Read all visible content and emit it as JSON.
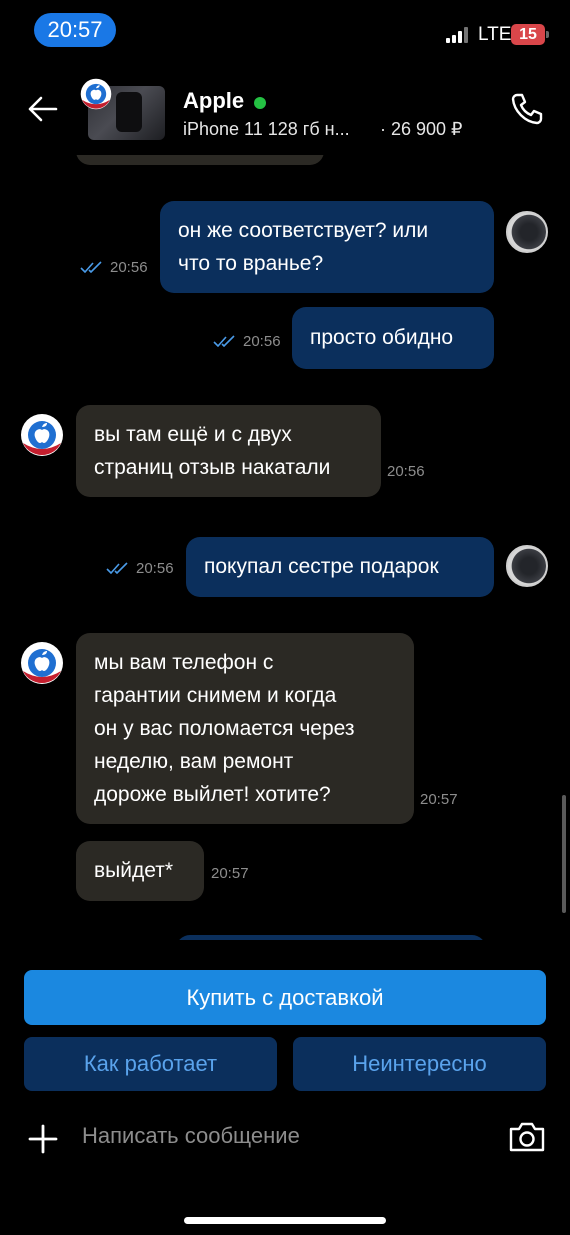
{
  "status_bar": {
    "time": "20:57",
    "network": "LTE",
    "battery": "15"
  },
  "header": {
    "seller_name": "Apple",
    "online_status_color": "#24c143",
    "product_title": "iPhone 11 128 гб н...",
    "product_price": "· 26 900 ₽"
  },
  "messages": [
    {
      "direction": "out",
      "lines": [
        "он же соответствует? или",
        "что то вранье?"
      ],
      "time": "20:56",
      "read": true
    },
    {
      "direction": "out",
      "lines": [
        "просто обидно"
      ],
      "time": "20:56",
      "read": true
    },
    {
      "direction": "in",
      "lines": [
        "вы там ещё и с двух",
        "страниц отзыв накатали"
      ],
      "time": "20:56"
    },
    {
      "direction": "out",
      "lines": [
        "покупал сестре подарок"
      ],
      "time": "20:56",
      "read": true
    },
    {
      "direction": "in",
      "lines": [
        "мы вам телефон с",
        "гарантии снимем и когда",
        "он у вас поломается через",
        "неделю, вам ремонт",
        "дороже выйлет! хотите?"
      ],
      "time": "20:57"
    },
    {
      "direction": "in",
      "lines": [
        "выйдет*"
      ],
      "time": "20:57"
    }
  ],
  "actions": {
    "buy_label": "Купить с доставкой",
    "how_it_works_label": "Как работает",
    "not_interested_label": "Неинтересно"
  },
  "composer": {
    "placeholder": "Написать сообщение"
  },
  "colors": {
    "accent": "#1b88e0",
    "outgoing_bubble": "#0b2f5c",
    "incoming_bubble": "#2b2924",
    "read_ticks": "#4a9be8"
  },
  "icons": [
    "back-arrow-icon",
    "apple-logo-icon",
    "phone-icon",
    "double-check-icon",
    "plus-icon",
    "camera-icon",
    "signal-icon"
  ]
}
